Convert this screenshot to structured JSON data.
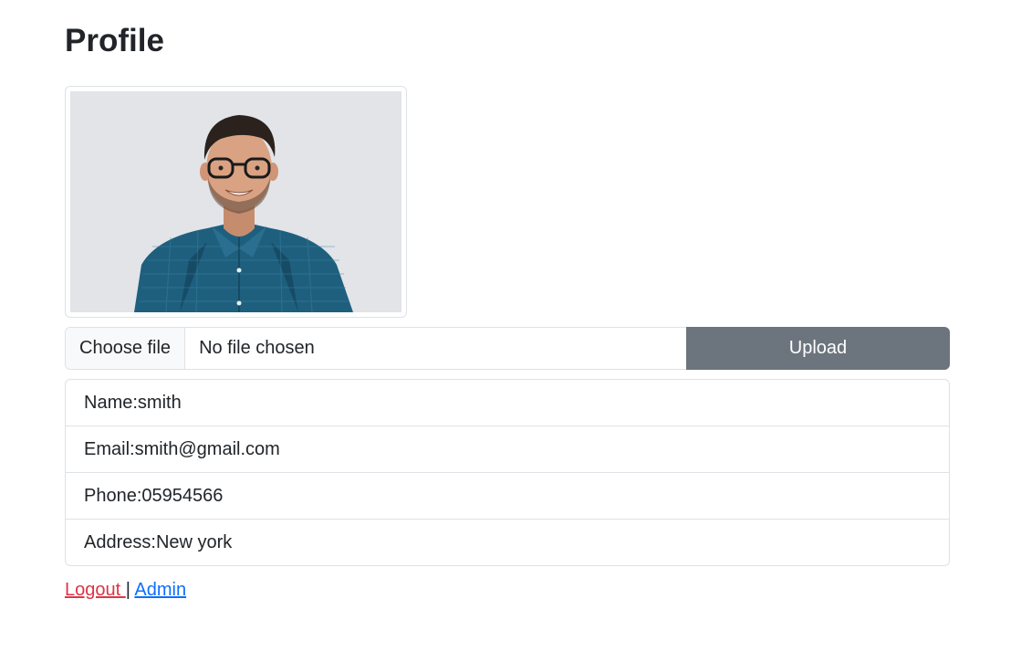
{
  "page": {
    "title": "Profile"
  },
  "photo": {
    "alt": "Profile photo"
  },
  "upload": {
    "choose_label": "Choose file",
    "status": "No file chosen",
    "button_label": "Upload"
  },
  "info": {
    "items": [
      {
        "label": "Name",
        "value": "smith"
      },
      {
        "label": "Email",
        "value": "smith@gmail.com"
      },
      {
        "label": "Phone",
        "value": "05954566"
      },
      {
        "label": "Address",
        "value": "New york"
      }
    ]
  },
  "footer": {
    "logout_label": "Logout ",
    "separator": "|",
    "admin_label": "Admin"
  },
  "colors": {
    "upload_button": "#6c757d",
    "logout_link": "#dc3545",
    "admin_link": "#0d6efd",
    "border": "#dee2e6"
  }
}
